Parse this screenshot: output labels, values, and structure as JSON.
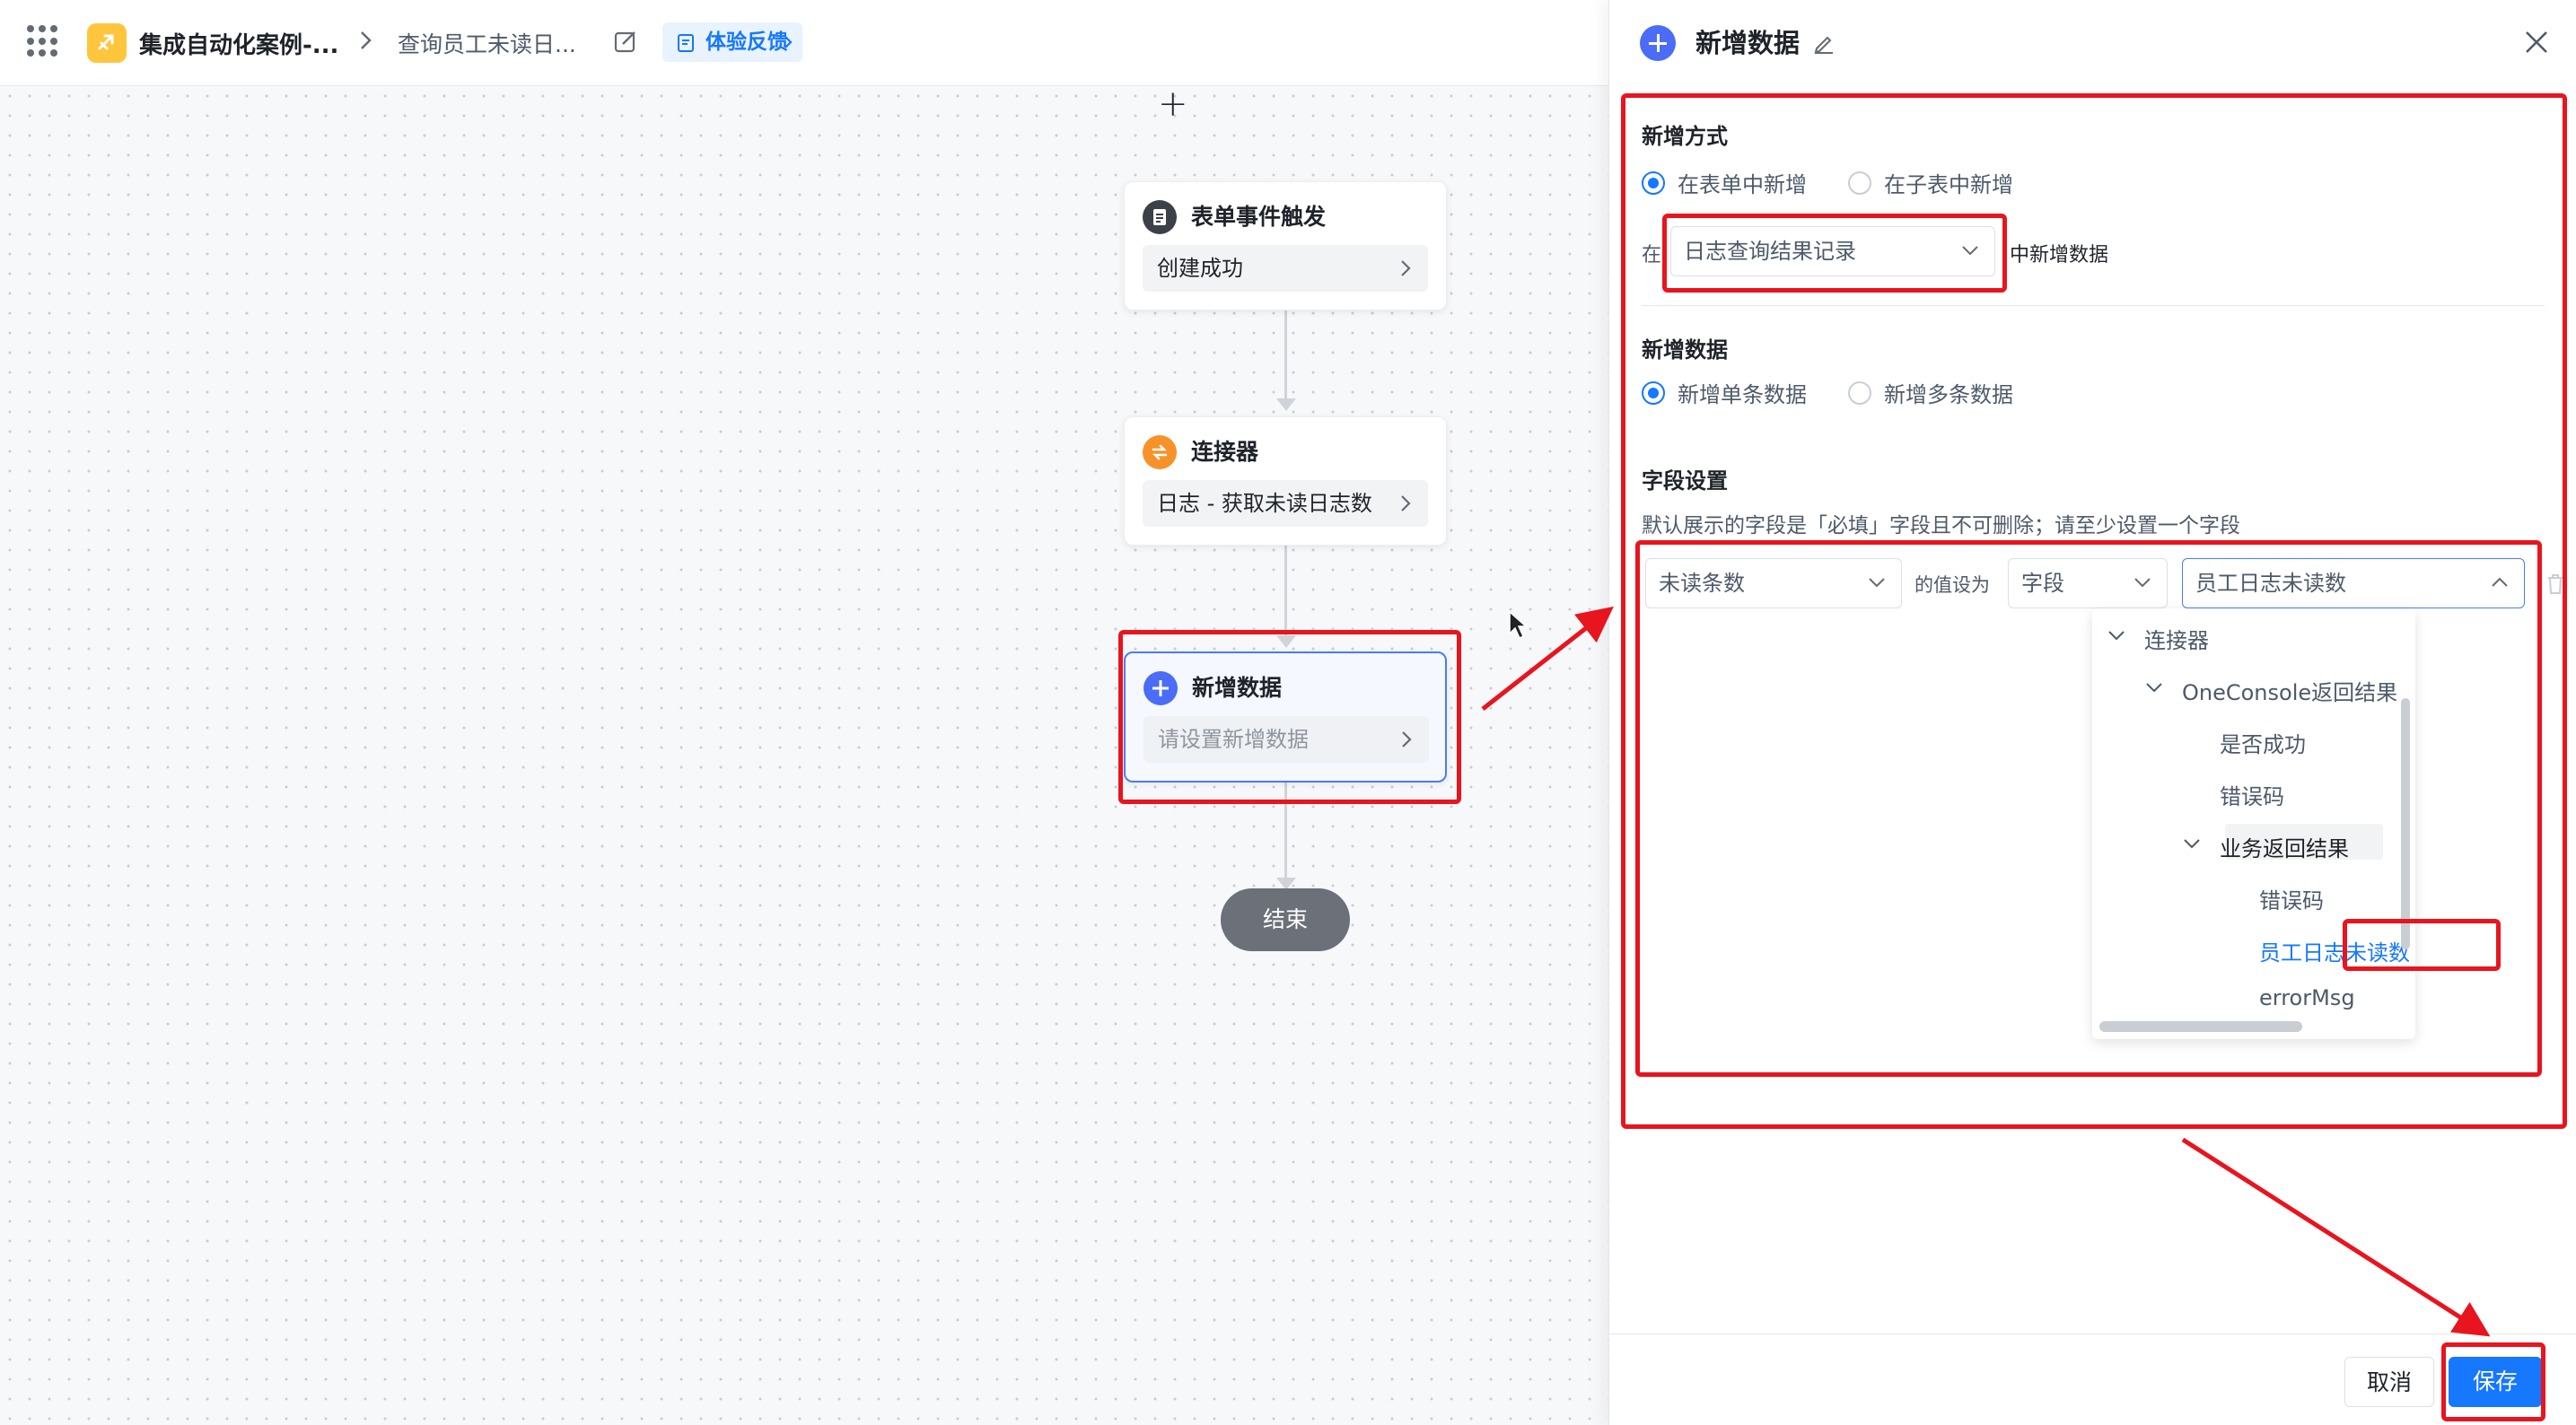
{
  "header": {
    "app_title": "集成自动化案例-...",
    "breadcrumb": "查询员工未读日...",
    "feedback_label": "体验反馈"
  },
  "canvas": {
    "add_symbol": "+",
    "nodes": [
      {
        "title": "表单事件触发",
        "body": "创建成功"
      },
      {
        "title": "连接器",
        "body": "日志 - 获取未读日志数"
      },
      {
        "title": "新增数据",
        "body": "请设置新增数据"
      }
    ],
    "end_label": "结束"
  },
  "panel": {
    "title": "新增数据",
    "add_mode": {
      "section_title": "新增方式",
      "options": [
        "在表单中新增",
        "在子表中新增"
      ],
      "selected": "在表单中新增",
      "prefix": "在",
      "form_select_value": "日志查询结果记录",
      "suffix": "中新增数据"
    },
    "add_data": {
      "section_title": "新增数据",
      "options": [
        "新增单条数据",
        "新增多条数据"
      ],
      "selected": "新增单条数据"
    },
    "field_settings": {
      "section_title": "字段设置",
      "description": "默认展示的字段是「必填」字段且不可删除；请至少设置一个字段",
      "row": {
        "field": "未读条数",
        "value_label": "的值设为",
        "value_type": "字段",
        "value": "员工日志未读数"
      },
      "dropdown_items": [
        {
          "label": "连接器",
          "expanded": true
        },
        {
          "label": "OneConsole返回结果",
          "expanded": true
        },
        {
          "label": "是否成功"
        },
        {
          "label": "错误码"
        },
        {
          "label": "业务返回结果",
          "expanded": true
        },
        {
          "label": "错误码"
        },
        {
          "label": "员工日志未读数",
          "selected": true
        },
        {
          "label": "errorMsg"
        }
      ]
    },
    "footer": {
      "cancel": "取消",
      "save": "保存"
    }
  },
  "colors": {
    "primary": "#1677ff",
    "annotation_red": "#e8141e",
    "app_icon": "#ffc53d",
    "connector_icon": "#f7922b",
    "add_icon": "#4a6cf7",
    "end_node": "#6b7079"
  }
}
